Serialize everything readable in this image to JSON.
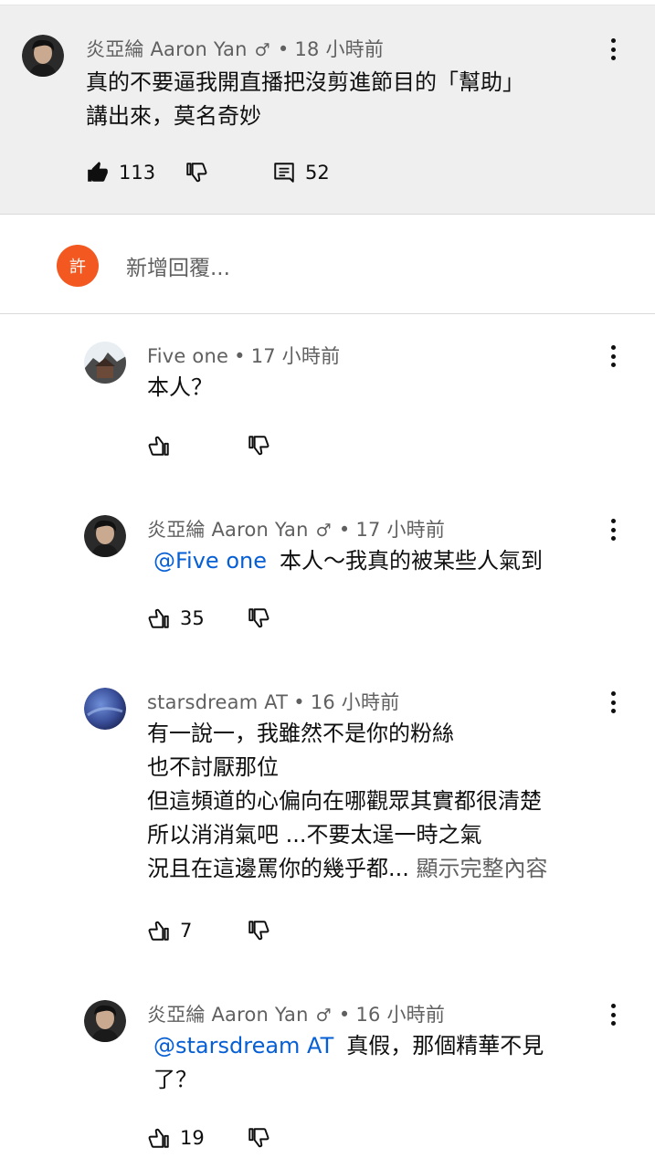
{
  "main_comment": {
    "author": "炎亞綸 Aaron Yan",
    "note_icon": "♂",
    "dot": "•",
    "time": "18 小時前",
    "lines": [
      "真的不要逼我開直播把沒剪進節目的「幫助」",
      "講出來，莫名奇妙"
    ],
    "likes": "113",
    "replies": "52"
  },
  "reply_box": {
    "avatar_letter": "許",
    "placeholder": "新增回覆..."
  },
  "replies": [
    {
      "author": "Five one",
      "dot": "•",
      "time": "17 小時前",
      "lines": [
        "本人？"
      ],
      "likes": ""
    },
    {
      "author": "炎亞綸 Aaron Yan",
      "note_icon": "♂",
      "dot": "•",
      "time": "17 小時前",
      "mention": "@Five one",
      "lines": [
        "本人～我真的被某些人氣到"
      ],
      "likes": "35"
    },
    {
      "author": "starsdream AT",
      "dot": "•",
      "time": "16 小時前",
      "lines": [
        "有一說一，我雖然不是你的粉絲",
        "也不討厭那位",
        "但這頻道的心偏向在哪觀眾其實都很清楚",
        "所以消消氣吧 ...不要太逞一時之氣",
        "況且在這邊罵你的幾乎都..."
      ],
      "show_more": "顯示完整內容",
      "likes": "7"
    },
    {
      "author": "炎亞綸 Aaron Yan",
      "note_icon": "♂",
      "dot": "•",
      "time": "16 小時前",
      "mention": "@starsdream AT",
      "lines": [
        "真假，那個精華不見",
        "了？"
      ],
      "likes": "19"
    }
  ],
  "icons": {
    "like": "thumb-up-icon",
    "dislike": "thumb-down-icon",
    "replies": "comment-icon",
    "menu": "more-vert-icon"
  },
  "colors": {
    "background_highlight": "#efefef",
    "mention_blue": "#065fd4",
    "reply_avatar": "#f2581f"
  }
}
